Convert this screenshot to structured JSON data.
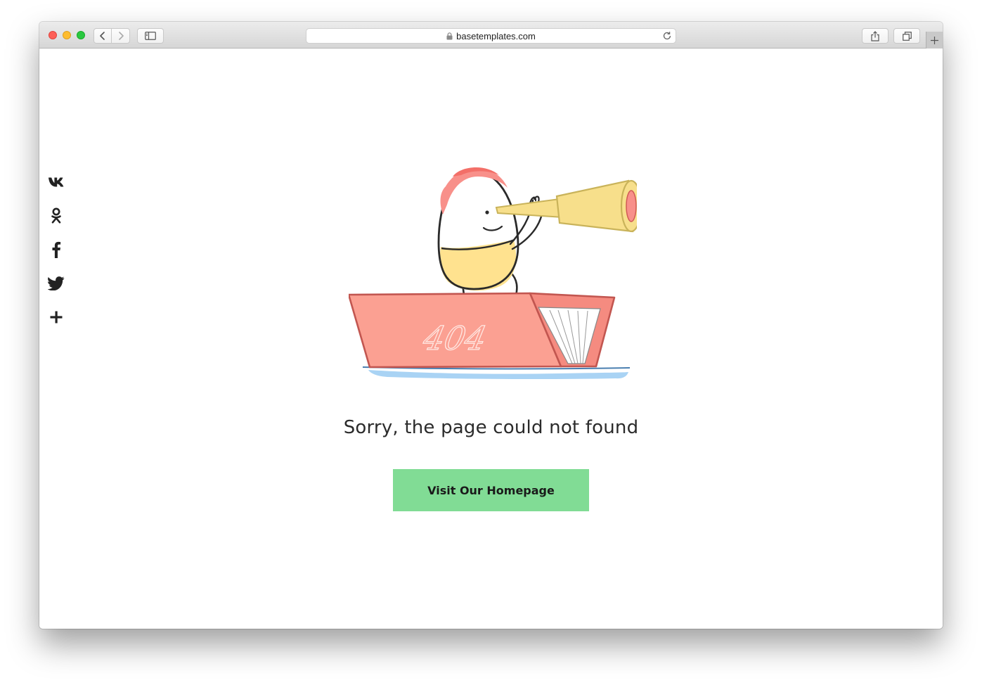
{
  "browser": {
    "url": "basetemplates.com",
    "icons": {
      "close": "close-dot",
      "minimize": "minimize-dot",
      "maximize": "maximize-dot",
      "back": "chevron-left-icon",
      "forward": "chevron-right-icon",
      "sidebar": "sidebar-icon",
      "lock": "lock-icon",
      "reload": "reload-icon",
      "share": "share-icon",
      "tabs": "tabs-icon",
      "new_tab": "plus-icon"
    }
  },
  "social": {
    "items": [
      {
        "name": "vk",
        "icon": "vk-icon"
      },
      {
        "name": "odnoklassniki",
        "icon": "odnoklassniki-icon"
      },
      {
        "name": "facebook",
        "icon": "facebook-icon"
      },
      {
        "name": "twitter",
        "icon": "twitter-icon"
      },
      {
        "name": "more",
        "icon": "plus-icon"
      }
    ]
  },
  "illustration": {
    "boat_text": "404"
  },
  "main": {
    "message": "Sorry, the page could not found",
    "button_label": "Visit Our Homepage"
  },
  "colors": {
    "button": "#81dc95",
    "boat": "#fba092",
    "character_body": "#ffe28f",
    "hair": "#f8908a",
    "telescope": "#f7df8b",
    "water": "#a9d3f4"
  }
}
